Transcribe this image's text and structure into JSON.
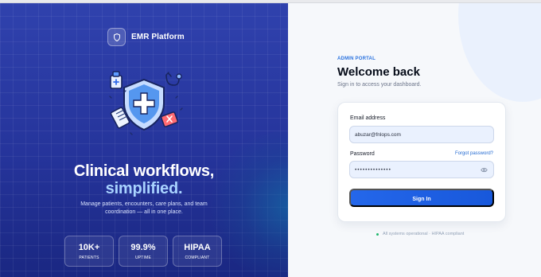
{
  "brand": {
    "name": "EMR Platform",
    "icon": "shield-icon"
  },
  "hero": {
    "headline_line1": "Clinical workflows,",
    "headline_accent": "simplified.",
    "description": "Manage patients, encounters, care plans, and team coordination — all in one place."
  },
  "stats": [
    {
      "value": "10K+",
      "label": "PATIENTS"
    },
    {
      "value": "99.9%",
      "label": "UPTIME"
    },
    {
      "value": "HIPAA",
      "label": "COMPLIANT"
    }
  ],
  "login": {
    "portal_label": "ADMIN PORTAL",
    "title": "Welcome back",
    "subtitle": "Sign in to access your dashboard.",
    "email_label": "Email address",
    "email_value": "abuzar@fnlops.com",
    "password_label": "Password",
    "password_value": "••••••••••••••",
    "forgot_label": "Forgot password?",
    "signin_label": "Sign In"
  },
  "status": {
    "text": "All systems operational · HIPAA compliant"
  },
  "colors": {
    "left_panel": "#2639a0",
    "accent_blue": "#1f63e6",
    "status_green": "#20b76d"
  }
}
